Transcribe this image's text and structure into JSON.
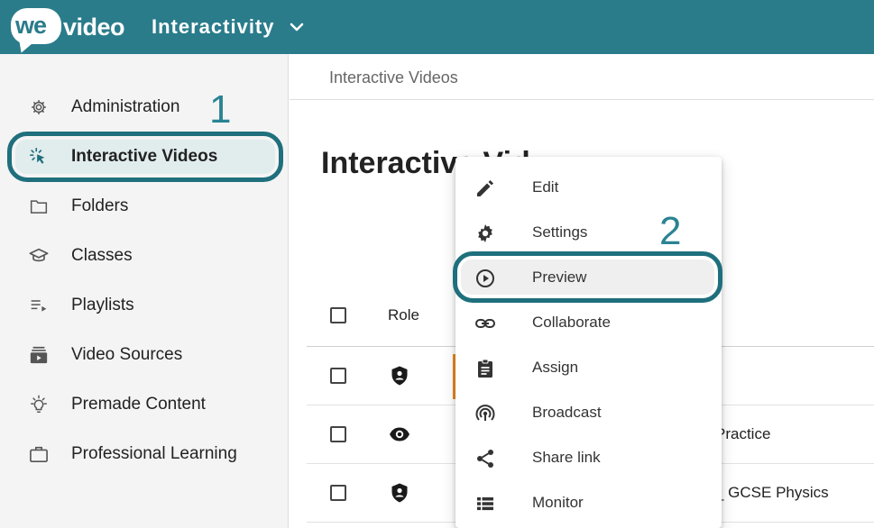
{
  "header": {
    "logo_we": "we",
    "logo_video": "video",
    "app_title": "Interactivity"
  },
  "sidebar": {
    "items": [
      {
        "label": "Administration",
        "icon": "gear-icon"
      },
      {
        "label": "Interactive Videos",
        "icon": "cursor-click-icon",
        "active": true
      },
      {
        "label": "Folders",
        "icon": "folder-icon"
      },
      {
        "label": "Classes",
        "icon": "graduation-cap-icon"
      },
      {
        "label": "Playlists",
        "icon": "playlist-icon"
      },
      {
        "label": "Video Sources",
        "icon": "video-library-icon"
      },
      {
        "label": "Premade Content",
        "icon": "lightbulb-icon"
      },
      {
        "label": "Professional Learning",
        "icon": "briefcase-icon"
      }
    ]
  },
  "annotations": {
    "step1": "1",
    "step2": "2"
  },
  "main": {
    "breadcrumb": "Interactive Videos",
    "title": "Interactive Vid",
    "table": {
      "headers": {
        "role": "Role"
      },
      "rows": [
        {
          "role_icon": "admin-shield-icon",
          "name": ""
        },
        {
          "role_icon": "eye-icon",
          "name": "Practice"
        },
        {
          "role_icon": "admin-shield-icon",
          "name": "_ GCSE Physics"
        }
      ]
    }
  },
  "context_menu": {
    "items": [
      {
        "label": "Edit",
        "icon": "pencil-icon"
      },
      {
        "label": "Settings",
        "icon": "gear-icon"
      },
      {
        "label": "Preview",
        "icon": "play-circle-icon",
        "highlighted": true
      },
      {
        "label": "Collaborate",
        "icon": "link-icon"
      },
      {
        "label": "Assign",
        "icon": "clipboard-icon"
      },
      {
        "label": "Broadcast",
        "icon": "broadcast-icon"
      },
      {
        "label": "Share link",
        "icon": "share-icon"
      },
      {
        "label": "Monitor",
        "icon": "list-icon"
      }
    ]
  },
  "colors": {
    "brand": "#2a7c8b",
    "highlight_ring": "#1f6f7d",
    "annotation": "#2a8393",
    "row_accent": "#e88a20"
  }
}
